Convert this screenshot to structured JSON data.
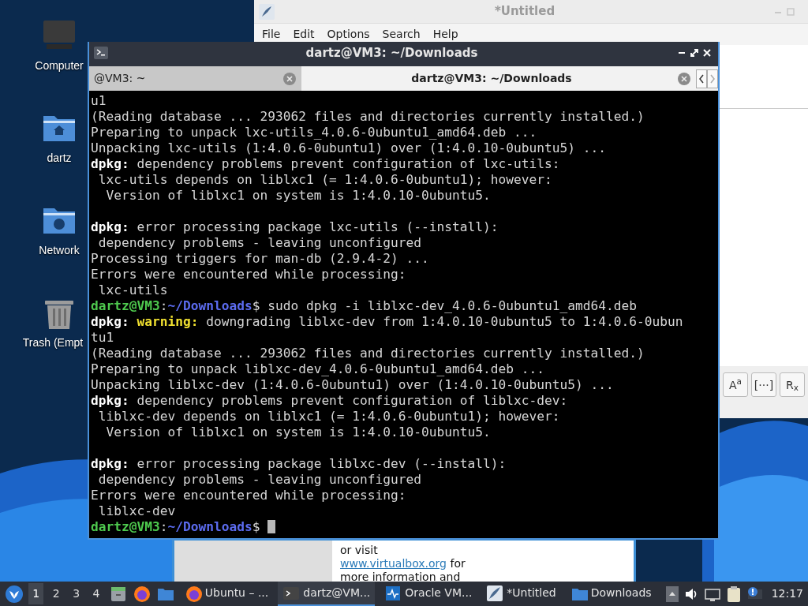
{
  "desktop_icons": [
    {
      "label": "Computer",
      "kind": "computer"
    },
    {
      "label": "dartz",
      "kind": "home"
    },
    {
      "label": "Network",
      "kind": "network"
    },
    {
      "label": "Trash (Empt",
      "kind": "trash"
    }
  ],
  "editor_window": {
    "title": "*Untitled",
    "menu": [
      "File",
      "Edit",
      "Options",
      "Search",
      "Help"
    ],
    "search_toggles": [
      "A$^{a}$",
      "[···]",
      "R$_{x}$"
    ]
  },
  "virtualbox_window": {
    "lines": [
      {
        "text": "or visit"
      },
      {
        "link": "www.virtualbox.org",
        "text": " for"
      },
      {
        "text": "more information and"
      }
    ]
  },
  "terminal": {
    "title": "dartz@VM3: ~/Downloads",
    "tabs": [
      {
        "label": "@VM3: ~",
        "selected": false
      },
      {
        "label": "dartz@VM3: ~/Downloads",
        "selected": true
      }
    ],
    "lines": [
      [
        {
          "kind": "plain",
          "text": "u1"
        }
      ],
      [
        {
          "kind": "plain",
          "text": "(Reading database ... 293062 files and directories currently installed.)"
        }
      ],
      [
        {
          "kind": "plain",
          "text": "Preparing to unpack lxc-utils_4.0.6-0ubuntu1_amd64.deb ..."
        }
      ],
      [
        {
          "kind": "plain",
          "text": "Unpacking lxc-utils (1:4.0.6-0ubuntu1) over (1:4.0.10-0ubuntu5) ..."
        }
      ],
      [
        {
          "kind": "bold",
          "text": "dpkg:"
        },
        {
          "kind": "plain",
          "text": " dependency problems prevent configuration of lxc-utils:"
        }
      ],
      [
        {
          "kind": "plain",
          "text": " lxc-utils depends on liblxc1 (= 1:4.0.6-0ubuntu1); however:"
        }
      ],
      [
        {
          "kind": "plain",
          "text": "  Version of liblxc1 on system is 1:4.0.10-0ubuntu5."
        }
      ],
      [
        {
          "kind": "blank"
        }
      ],
      [
        {
          "kind": "bold",
          "text": "dpkg:"
        },
        {
          "kind": "plain",
          "text": " error processing package lxc-utils (--install):"
        }
      ],
      [
        {
          "kind": "plain",
          "text": " dependency problems - leaving unconfigured"
        }
      ],
      [
        {
          "kind": "plain",
          "text": "Processing triggers for man-db (2.9.4-2) ..."
        }
      ],
      [
        {
          "kind": "plain",
          "text": "Errors were encountered while processing:"
        }
      ],
      [
        {
          "kind": "plain",
          "text": " lxc-utils"
        }
      ],
      [
        {
          "kind": "user",
          "text": "dartz@VM3"
        },
        {
          "kind": "plain",
          "text": ":"
        },
        {
          "kind": "path",
          "text": "~/Downloads"
        },
        {
          "kind": "plain",
          "text": "$ sudo dpkg -i liblxc-dev_4.0.6-0ubuntu1_amd64.deb"
        }
      ],
      [
        {
          "kind": "bold",
          "text": "dpkg:"
        },
        {
          "kind": "warning",
          "text": " warning:"
        },
        {
          "kind": "plain",
          "text": " downgrading liblxc-dev from 1:4.0.10-0ubuntu5 to 1:4.0.6-0ubun"
        }
      ],
      [
        {
          "kind": "plain",
          "text": "tu1"
        }
      ],
      [
        {
          "kind": "plain",
          "text": "(Reading database ... 293062 files and directories currently installed.)"
        }
      ],
      [
        {
          "kind": "plain",
          "text": "Preparing to unpack liblxc-dev_4.0.6-0ubuntu1_amd64.deb ..."
        }
      ],
      [
        {
          "kind": "plain",
          "text": "Unpacking liblxc-dev (1:4.0.6-0ubuntu1) over (1:4.0.10-0ubuntu5) ..."
        }
      ],
      [
        {
          "kind": "bold",
          "text": "dpkg:"
        },
        {
          "kind": "plain",
          "text": " dependency problems prevent configuration of liblxc-dev:"
        }
      ],
      [
        {
          "kind": "plain",
          "text": " liblxc-dev depends on liblxc1 (= 1:4.0.6-0ubuntu1); however:"
        }
      ],
      [
        {
          "kind": "plain",
          "text": "  Version of liblxc1 on system is 1:4.0.10-0ubuntu5."
        }
      ],
      [
        {
          "kind": "blank"
        }
      ],
      [
        {
          "kind": "bold",
          "text": "dpkg:"
        },
        {
          "kind": "plain",
          "text": " error processing package liblxc-dev (--install):"
        }
      ],
      [
        {
          "kind": "plain",
          "text": " dependency problems - leaving unconfigured"
        }
      ],
      [
        {
          "kind": "plain",
          "text": "Errors were encountered while processing:"
        }
      ],
      [
        {
          "kind": "plain",
          "text": " liblxc-dev"
        }
      ],
      [
        {
          "kind": "user",
          "text": "dartz@VM3"
        },
        {
          "kind": "plain",
          "text": ":"
        },
        {
          "kind": "path",
          "text": "~/Downloads"
        },
        {
          "kind": "plain",
          "text": "$ "
        }
      ]
    ],
    "cursor": true
  },
  "taskbar": {
    "workspaces": [
      {
        "label": "1",
        "selected": true
      },
      {
        "label": "2",
        "selected": false
      },
      {
        "label": "3",
        "selected": false
      },
      {
        "label": "4",
        "selected": false
      }
    ],
    "launchers": [
      {
        "kind": "files"
      },
      {
        "kind": "browser"
      },
      {
        "kind": "folder"
      }
    ],
    "tasks": [
      {
        "label": "Ubuntu – ...",
        "kind": "browser",
        "selected": false
      },
      {
        "label": "dartz@VM...",
        "kind": "terminal",
        "selected": true
      },
      {
        "label": "Oracle VM...",
        "kind": "vbox",
        "selected": false
      },
      {
        "label": "*Untitled",
        "kind": "editor",
        "selected": false
      },
      {
        "label": "Downloads",
        "kind": "folder",
        "selected": false
      }
    ],
    "clock": "12:17"
  }
}
